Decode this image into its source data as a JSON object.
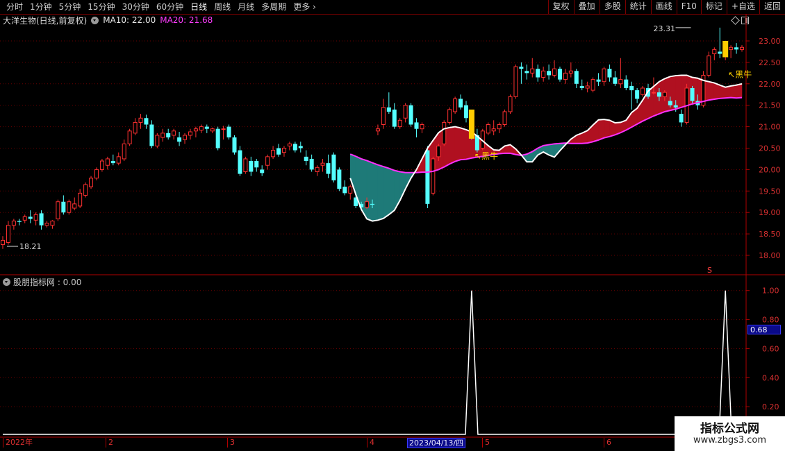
{
  "toolbar": {
    "periods": [
      "分时",
      "1分钟",
      "5分钟",
      "15分钟",
      "30分钟",
      "60分钟",
      "日线",
      "周线",
      "月线",
      "多周期",
      "更多"
    ],
    "active_period": "日线",
    "buttons": [
      "复权",
      "叠加",
      "多股",
      "统计",
      "画线",
      "F10",
      "标记",
      "+自选",
      "返回"
    ]
  },
  "main_chart": {
    "stock_name": "大洋生物(日线,前复权)",
    "ma10_label": "MA10: 22.00",
    "ma20_label": "MA20: 21.68",
    "price_axis": [
      "23.00",
      "22.50",
      "22.00",
      "21.50",
      "21.00",
      "20.50",
      "20.00",
      "19.50",
      "19.00",
      "18.50",
      "18.00"
    ],
    "high_marker": "23.31",
    "low_marker": "18.21",
    "signal_text": "黑牛",
    "s_marker": "S"
  },
  "sub_chart": {
    "indicator_name": "股朋指标网 : 0.00",
    "axis": [
      "1.00",
      "0.80",
      "0.60",
      "0.40",
      "0.20"
    ],
    "current_value": "0.68"
  },
  "x_axis": {
    "labels": [
      "2022年",
      "2",
      "3",
      "4",
      "5",
      "6"
    ],
    "cursor_date": "2023/04/13/四"
  },
  "watermark": {
    "title": "指标公式网",
    "url": "www.zbgs3.com"
  },
  "colors": {
    "up": "#ff3030",
    "down": "#54ffff",
    "ma10": "#ffffff",
    "ma20": "#ff30ff",
    "fill_bull": "#b01020",
    "fill_bear": "#1e7a78",
    "signal": "#ffcc00",
    "grid": "#7a0000"
  },
  "chart_data": {
    "type": "candlestick",
    "title": "大洋生物(日线,前复权)",
    "ylim": [
      17.75,
      23.4
    ],
    "candles": [
      [
        18.25,
        18.45,
        18.15,
        18.35
      ],
      [
        18.3,
        18.8,
        18.25,
        18.7
      ],
      [
        18.7,
        18.85,
        18.6,
        18.8
      ],
      [
        18.8,
        18.85,
        18.7,
        18.78
      ],
      [
        18.82,
        18.95,
        18.75,
        18.9
      ],
      [
        18.9,
        19.05,
        18.75,
        18.85
      ],
      [
        18.82,
        19.0,
        18.7,
        18.95
      ],
      [
        18.98,
        19.05,
        18.6,
        18.7
      ],
      [
        18.7,
        18.8,
        18.65,
        18.75
      ],
      [
        18.7,
        18.82,
        18.62,
        18.8
      ],
      [
        18.85,
        19.3,
        18.8,
        19.25
      ],
      [
        19.25,
        19.4,
        18.95,
        19.0
      ],
      [
        19.0,
        19.3,
        18.95,
        19.25
      ],
      [
        19.1,
        19.35,
        19.05,
        19.2
      ],
      [
        19.15,
        19.55,
        19.1,
        19.45
      ],
      [
        19.4,
        19.7,
        19.35,
        19.65
      ],
      [
        19.6,
        19.85,
        19.55,
        19.8
      ],
      [
        19.8,
        20.05,
        19.75,
        20.0
      ],
      [
        20.0,
        20.25,
        19.95,
        20.2
      ],
      [
        20.1,
        20.3,
        20.0,
        20.25
      ],
      [
        20.2,
        20.35,
        20.1,
        20.15
      ],
      [
        20.15,
        20.4,
        20.1,
        20.3
      ],
      [
        20.25,
        20.7,
        20.2,
        20.6
      ],
      [
        20.6,
        20.95,
        20.55,
        20.9
      ],
      [
        20.85,
        21.2,
        20.8,
        21.1
      ],
      [
        21.1,
        21.3,
        20.95,
        21.2
      ],
      [
        21.2,
        21.28,
        20.95,
        21.05
      ],
      [
        21.05,
        21.15,
        20.5,
        20.55
      ],
      [
        20.55,
        20.85,
        20.5,
        20.8
      ],
      [
        20.75,
        20.95,
        20.65,
        20.85
      ],
      [
        20.85,
        20.95,
        20.7,
        20.75
      ],
      [
        20.8,
        20.95,
        20.7,
        20.9
      ],
      [
        20.75,
        20.88,
        20.55,
        20.65
      ],
      [
        20.7,
        20.85,
        20.6,
        20.8
      ],
      [
        20.8,
        20.95,
        20.7,
        20.88
      ],
      [
        20.9,
        21.0,
        20.75,
        20.95
      ],
      [
        20.92,
        21.05,
        20.85,
        21.0
      ],
      [
        21.0,
        21.05,
        20.85,
        20.95
      ],
      [
        20.9,
        20.98,
        20.85,
        20.95
      ],
      [
        20.95,
        21.0,
        20.45,
        20.5
      ],
      [
        20.95,
        21.02,
        20.7,
        20.95
      ],
      [
        21.0,
        21.05,
        20.7,
        20.75
      ],
      [
        20.75,
        20.8,
        20.35,
        20.4
      ],
      [
        20.45,
        20.55,
        19.85,
        19.9
      ],
      [
        19.95,
        20.3,
        19.9,
        20.25
      ],
      [
        20.2,
        20.3,
        19.85,
        19.95
      ],
      [
        20.2,
        20.25,
        19.95,
        20.05
      ],
      [
        20.0,
        20.1,
        19.85,
        19.92
      ],
      [
        20.1,
        20.35,
        20.0,
        20.3
      ],
      [
        20.3,
        20.55,
        20.25,
        20.45
      ],
      [
        20.5,
        20.6,
        20.3,
        20.35
      ],
      [
        20.4,
        20.55,
        20.3,
        20.5
      ],
      [
        20.55,
        20.65,
        20.45,
        20.6
      ],
      [
        20.6,
        20.65,
        20.4,
        20.45
      ],
      [
        20.55,
        20.65,
        20.4,
        20.5
      ],
      [
        20.3,
        20.45,
        20.1,
        20.2
      ],
      [
        20.25,
        20.35,
        19.95,
        20.0
      ],
      [
        19.95,
        20.1,
        19.85,
        20.05
      ],
      [
        20.1,
        20.25,
        19.95,
        20.15
      ],
      [
        20.15,
        20.35,
        19.8,
        19.9
      ],
      [
        20.35,
        20.4,
        19.7,
        19.75
      ],
      [
        20.0,
        20.05,
        19.5,
        19.55
      ],
      [
        19.6,
        19.75,
        19.4,
        19.45
      ],
      [
        19.45,
        19.65,
        19.3,
        19.6
      ],
      [
        19.35,
        19.45,
        19.1,
        19.15
      ],
      [
        19.2,
        19.25,
        19.05,
        19.12
      ],
      [
        19.12,
        19.35,
        19.08,
        19.25
      ],
      [
        19.2,
        19.3,
        19.1,
        19.18
      ],
      [
        20.9,
        21.05,
        20.8,
        20.95
      ],
      [
        21.05,
        21.65,
        20.95,
        21.45
      ],
      [
        21.45,
        21.8,
        21.3,
        21.35
      ],
      [
        21.4,
        21.55,
        20.95,
        21.0
      ],
      [
        21.0,
        21.2,
        20.95,
        21.15
      ],
      [
        21.2,
        21.55,
        21.1,
        21.5
      ],
      [
        21.5,
        21.55,
        21.0,
        21.05
      ],
      [
        21.1,
        21.2,
        20.75,
        20.95
      ],
      [
        20.95,
        21.1,
        20.85,
        21.05
      ],
      [
        20.45,
        20.55,
        19.1,
        19.2
      ],
      [
        19.45,
        20.3,
        19.4,
        20.25
      ],
      [
        20.3,
        20.6,
        20.2,
        20.55
      ],
      [
        20.6,
        21.15,
        20.55,
        21.1
      ],
      [
        21.1,
        21.45,
        21.05,
        21.4
      ],
      [
        21.35,
        21.7,
        21.3,
        21.65
      ],
      [
        21.65,
        21.75,
        21.4,
        21.45
      ],
      [
        21.5,
        21.6,
        21.1,
        21.2
      ],
      [
        21.15,
        21.25,
        20.7,
        20.8
      ],
      [
        20.8,
        20.95,
        20.4,
        20.45
      ],
      [
        20.5,
        20.95,
        20.45,
        20.9
      ],
      [
        20.85,
        21.1,
        20.8,
        21.05
      ],
      [
        20.9,
        21.15,
        20.8,
        20.95
      ],
      [
        20.95,
        21.1,
        20.85,
        21.05
      ],
      [
        21.05,
        21.4,
        21.0,
        21.35
      ],
      [
        21.35,
        21.75,
        21.3,
        21.7
      ],
      [
        21.7,
        22.45,
        21.65,
        22.4
      ],
      [
        22.4,
        22.5,
        22.0,
        22.35
      ],
      [
        22.3,
        22.45,
        22.1,
        22.25
      ],
      [
        22.25,
        22.6,
        22.15,
        22.35
      ],
      [
        22.35,
        22.45,
        22.05,
        22.15
      ],
      [
        22.15,
        22.4,
        22.05,
        22.3
      ],
      [
        22.3,
        22.45,
        22.1,
        22.2
      ],
      [
        22.2,
        22.55,
        22.15,
        22.35
      ],
      [
        22.35,
        22.4,
        22.05,
        22.1
      ],
      [
        22.1,
        22.35,
        22.0,
        22.25
      ],
      [
        22.25,
        22.5,
        22.15,
        22.3
      ],
      [
        22.3,
        22.35,
        21.9,
        22.0
      ],
      [
        21.95,
        22.1,
        21.85,
        21.9
      ],
      [
        21.9,
        22.05,
        21.8,
        21.95
      ],
      [
        21.85,
        22.15,
        21.8,
        22.1
      ],
      [
        22.1,
        22.25,
        21.95,
        22.05
      ],
      [
        22.05,
        22.4,
        21.95,
        22.35
      ],
      [
        22.35,
        22.45,
        22.05,
        22.15
      ],
      [
        22.15,
        22.3,
        21.95,
        22.0
      ],
      [
        22.0,
        22.6,
        21.9,
        22.1
      ],
      [
        22.1,
        22.2,
        21.85,
        21.9
      ],
      [
        21.95,
        22.05,
        21.4,
        21.85
      ],
      [
        21.85,
        21.9,
        21.55,
        21.65
      ],
      [
        21.75,
        21.95,
        21.7,
        21.9
      ],
      [
        21.9,
        22.0,
        21.65,
        21.7
      ],
      [
        21.8,
        22.15,
        21.75,
        21.8
      ],
      [
        21.8,
        21.9,
        21.6,
        21.7
      ],
      [
        21.7,
        21.85,
        21.6,
        21.8
      ],
      [
        21.6,
        21.7,
        21.45,
        21.5
      ],
      [
        21.5,
        21.62,
        21.35,
        21.45
      ],
      [
        21.3,
        21.4,
        21.0,
        21.1
      ],
      [
        21.1,
        22.0,
        21.05,
        21.9
      ],
      [
        21.9,
        21.95,
        21.55,
        21.6
      ],
      [
        21.6,
        21.75,
        21.4,
        21.5
      ],
      [
        21.5,
        22.3,
        21.45,
        22.2
      ],
      [
        22.2,
        22.75,
        22.15,
        22.65
      ],
      [
        22.7,
        22.85,
        22.55,
        22.8
      ],
      [
        22.75,
        23.31,
        22.6,
        22.7
      ],
      [
        22.7,
        22.85,
        22.55,
        22.75
      ],
      [
        22.8,
        22.9,
        22.6,
        22.85
      ],
      [
        22.85,
        22.95,
        22.7,
        22.8
      ],
      [
        22.8,
        22.9,
        22.75,
        22.85
      ]
    ],
    "ma10": [
      19.8,
      19.42,
      19.07,
      18.85,
      18.8,
      18.82,
      18.86,
      18.95,
      19.05,
      19.28,
      19.55,
      19.8,
      20.0,
      20.25,
      20.5,
      20.68,
      20.86,
      20.95,
      20.98,
      21.0,
      20.97,
      20.93,
      20.88,
      20.78,
      20.67,
      20.56,
      20.46,
      20.45,
      20.55,
      20.58,
      20.48,
      20.34,
      20.18,
      20.18,
      20.34,
      20.41,
      20.34,
      20.29,
      20.44,
      20.58,
      20.71,
      20.8,
      20.85,
      20.91,
      21.04,
      21.16,
      21.17,
      21.15,
      21.09,
      21.1,
      21.15,
      21.33,
      21.43,
      21.62,
      21.83,
      21.94,
      22.05,
      22.12,
      22.17,
      22.19,
      22.2,
      22.2,
      22.15,
      22.13,
      22.08,
      22.05,
      22.02,
      21.97,
      21.92,
      21.95,
      21.97,
      22.0
    ],
    "ma20": [
      20.36,
      20.31,
      20.25,
      20.21,
      20.16,
      20.11,
      20.07,
      20.03,
      19.98,
      19.95,
      19.93,
      19.93,
      19.93,
      19.94,
      19.94,
      19.96,
      20.0,
      20.06,
      20.13,
      20.19,
      20.23,
      20.24,
      20.27,
      20.29,
      20.31,
      20.33,
      20.35,
      20.37,
      20.38,
      20.38,
      20.35,
      20.33,
      20.36,
      20.42,
      20.5,
      20.56,
      20.58,
      20.6,
      20.61,
      20.62,
      20.61,
      20.61,
      20.61,
      20.62,
      20.65,
      20.69,
      20.74,
      20.77,
      20.81,
      20.86,
      20.92,
      20.99,
      21.06,
      21.13,
      21.19,
      21.25,
      21.3,
      21.35,
      21.38,
      21.41,
      21.45,
      21.49,
      21.53,
      21.56,
      21.59,
      21.62,
      21.64,
      21.66,
      21.67,
      21.68,
      21.67,
      21.68
    ],
    "signal_bars": [
      {
        "index": 85,
        "value": 1.0
      },
      {
        "index": 131,
        "value": 1.0
      }
    ],
    "indicator_ylim": [
      0,
      1.08
    ]
  }
}
